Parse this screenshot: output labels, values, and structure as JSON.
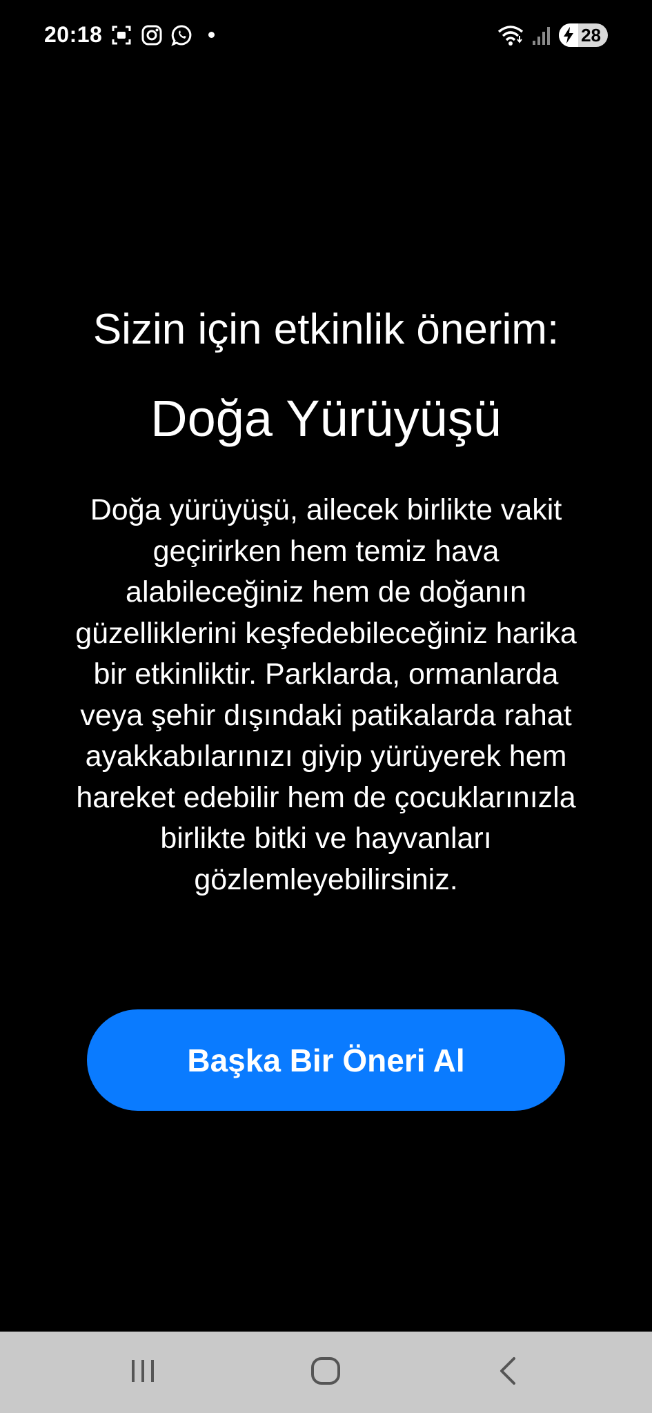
{
  "status_bar": {
    "time": "20:18",
    "battery_level": "28",
    "notification_icons": [
      "screenshot-icon",
      "instagram-icon",
      "whatsapp-icon"
    ],
    "system_icons": [
      "wifi-icon",
      "signal-icon",
      "battery-charging-icon"
    ]
  },
  "main": {
    "heading": "Sizin için etkinlik önerim:",
    "activity_title": "Doğa Yürüyüşü",
    "description": "Doğa yürüyüşü, ailecek birlikte vakit geçirirken hem temiz hava alabileceğiniz hem de doğanın güzelliklerini keşfedebileceğiniz harika bir etkinliktir. Parklarda, ormanlarda veya şehir dışındaki patikalarda rahat ayakkabılarınızı giyip yürüyerek hem hareket edebilir hem de çocuklarınızla birlikte bitki ve hayvanları gözlemleyebilirsiniz.",
    "button_label": "Başka Bir Öneri Al"
  },
  "navigation_bar": {
    "buttons": [
      "recent-apps-icon",
      "home-icon",
      "back-icon"
    ]
  },
  "colors": {
    "background": "#000000",
    "text": "#ffffff",
    "button": "#0a7bff",
    "nav_bar": "#c9c9c9"
  }
}
